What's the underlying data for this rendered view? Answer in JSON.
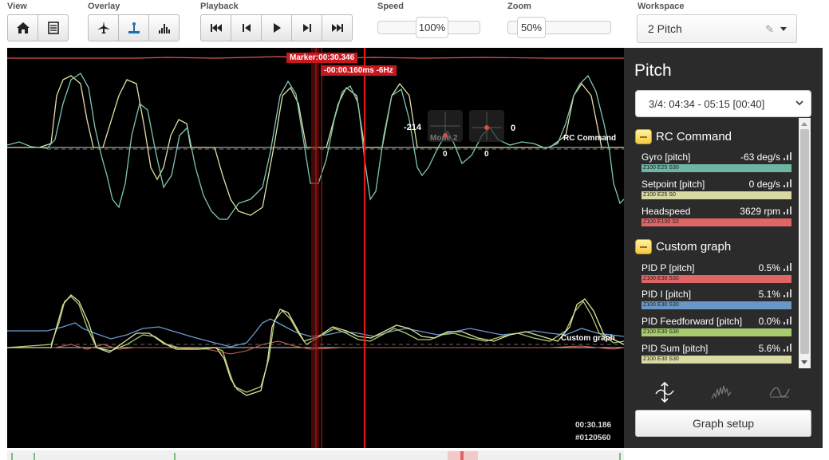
{
  "toolbar": {
    "view_label": "View",
    "overlay_label": "Overlay",
    "playback_label": "Playback",
    "speed_label": "Speed",
    "speed_value": "100%",
    "zoom_label": "Zoom",
    "zoom_value": "50%",
    "workspace_label": "Workspace",
    "workspace_value": "2  Pitch",
    "buttons": {
      "view": [
        "home-icon",
        "log-icon"
      ],
      "overlay": [
        "craft-icon",
        "sticks-icon",
        "spectrum-icon"
      ],
      "playback": [
        "jump-start-icon",
        "step-back-icon",
        "play-icon",
        "step-forward-icon",
        "jump-end-icon"
      ]
    }
  },
  "graph": {
    "marker_label": "Marker:00:30.346",
    "delta_label": "-00:00.160ms -6Hz",
    "stick_left_value": "-214",
    "stick_left_bottom": "0",
    "stick_right_value": "0",
    "stick_right_bottom": "0",
    "mode_text": "Mode 2",
    "rc_label": "RC Command",
    "custom_label": "Custom graph",
    "time": "00:30.186",
    "frame": "#0120560",
    "colors": {
      "gyro": "#7ec7b0",
      "setpoint": "#e0e2a3",
      "headspeed": "#e06060",
      "pid_p": "#e07060",
      "pid_i": "#6a9ad0",
      "pid_ff": "#a8cc70",
      "pid_sum": "#e2e2a0",
      "cursor": "#e01818"
    }
  },
  "panel": {
    "title": "Pitch",
    "range": "3/4: 04:34 - 05:15 [00:40]",
    "groups": [
      {
        "name": "RC Command",
        "fields": [
          {
            "name": "Gyro [pitch]",
            "value": "-63 deg/s",
            "bar": "Z100 E25 S30",
            "color": "#6fb5a3"
          },
          {
            "name": "Setpoint [pitch]",
            "value": "0 deg/s",
            "bar": "Z100 E25 S0",
            "color": "#d9d9a2"
          },
          {
            "name": "Headspeed",
            "value": "3629 rpm",
            "bar": "Z100 E100 S0",
            "color": "#e06666"
          }
        ]
      },
      {
        "name": "Custom graph",
        "fields": [
          {
            "name": "PID P [pitch]",
            "value": "0.5%",
            "bar": "Z100 E30 S30",
            "color": "#e06666"
          },
          {
            "name": "PID I [pitch]",
            "value": "5.1%",
            "bar": "Z100 E30 S30",
            "color": "#6a98c6"
          },
          {
            "name": "PID Feedforward [pitch]",
            "value": "0.0%",
            "bar": "Z100 E30 S30",
            "color": "#a6cc6e"
          },
          {
            "name": "PID Sum [pitch]",
            "value": "5.6%",
            "bar": "Z100 E30 S30",
            "color": "#d9d9a2"
          }
        ]
      }
    ],
    "setup_button": "Graph setup"
  }
}
